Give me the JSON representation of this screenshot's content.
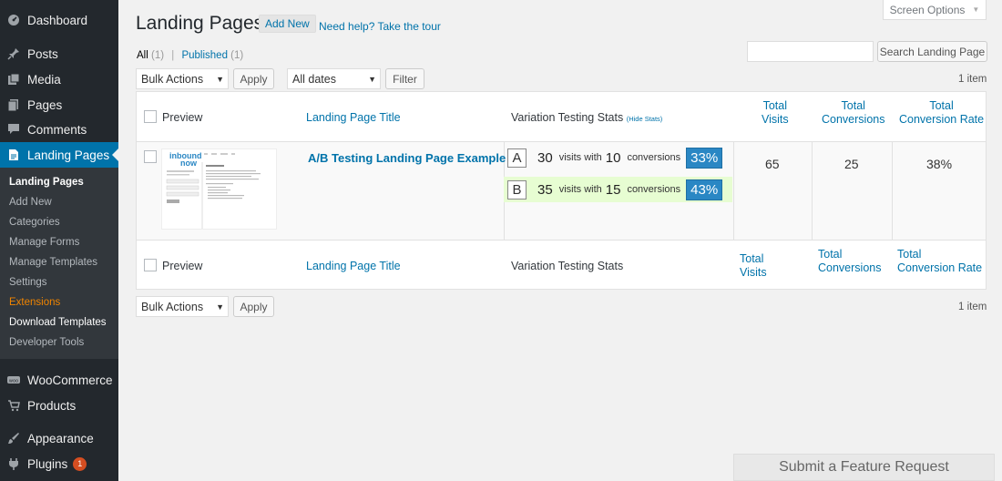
{
  "sidebar": {
    "menu": [
      {
        "label": "Dashboard",
        "icon": "dashboard-icon"
      },
      {
        "label": "Posts",
        "icon": "pin-icon"
      },
      {
        "label": "Media",
        "icon": "media-icon"
      },
      {
        "label": "Pages",
        "icon": "pages-icon"
      },
      {
        "label": "Comments",
        "icon": "comment-icon"
      },
      {
        "label": "Landing Pages",
        "icon": "document-icon"
      },
      {
        "label": "WooCommerce",
        "icon": "woo-icon"
      },
      {
        "label": "Products",
        "icon": "cart-icon"
      },
      {
        "label": "Appearance",
        "icon": "brush-icon"
      },
      {
        "label": "Plugins",
        "icon": "plug-icon",
        "badge": "1"
      }
    ],
    "submenu": [
      "Landing Pages",
      "Add New",
      "Categories",
      "Manage Forms",
      "Manage Templates",
      "Settings",
      "Extensions",
      "Download Templates",
      "Developer Tools"
    ]
  },
  "header": {
    "title": "Landing Pages",
    "add_new": "Add New",
    "help": "Need help? Take the tour",
    "screen_options": "Screen Options"
  },
  "filters": {
    "all": "All",
    "all_count": "(1)",
    "sep": "|",
    "published": "Published",
    "published_count": "(1)",
    "search_button": "Search Landing Page",
    "bulk_actions": "Bulk Actions",
    "apply": "Apply",
    "dates": "All dates",
    "filter": "Filter",
    "items_count": "1 item"
  },
  "table": {
    "columns": {
      "preview": "Preview",
      "title": "Landing Page Title",
      "stats": "Variation Testing Stats",
      "hide_stats": "(Hide Stats)",
      "visits_1": "Total",
      "visits_2": "Visits",
      "conv_1": "Total",
      "conv_2": "Conversions",
      "rate_1": "Total",
      "rate_2": "Conversion Rate"
    },
    "row": {
      "title": "A/B Testing Landing Page Example",
      "thumb_logo_1": "inbound",
      "thumb_logo_2": "now",
      "variations": [
        {
          "letter": "A",
          "visits": "30",
          "visits_text": "visits with",
          "conversions": "10",
          "conv_text": "conversions",
          "rate": "33%"
        },
        {
          "letter": "B",
          "visits": "35",
          "visits_text": "visits with",
          "conversions": "15",
          "conv_text": "conversions",
          "rate": "43%"
        }
      ],
      "total_visits": "65",
      "total_conversions": "25",
      "conversion_rate": "38%"
    }
  },
  "footer": {
    "feature_request": "Submit a Feature Request"
  },
  "colors": {
    "sidebar_bg": "#23282d",
    "active": "#0073aa",
    "rate_bg": "#2a87c4",
    "variation_b_bg": "#e7fdd2",
    "extensions": "#f18500"
  }
}
